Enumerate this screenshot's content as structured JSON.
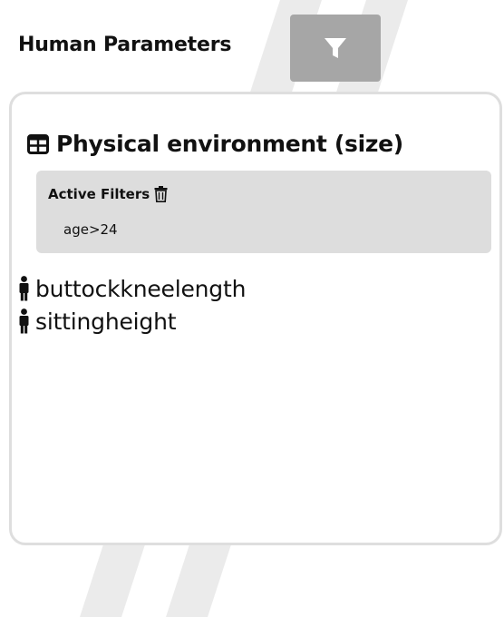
{
  "header": {
    "title": "Human Parameters",
    "filter_button_icon": "filter-icon"
  },
  "panel": {
    "title_icon": "table-icon",
    "title": "Physical environment (size)",
    "active_filters": {
      "label": "Active Filters",
      "delete_icon": "trash-icon",
      "items": [
        "age>24"
      ]
    },
    "parameters": [
      {
        "icon": "person-icon",
        "label": "buttockkneelength"
      },
      {
        "icon": "person-icon",
        "label": "sittingheight"
      }
    ]
  },
  "colors": {
    "filter_button_bg": "#a6a6a6",
    "active_filters_bg": "#dddddd",
    "panel_border": "#dedede",
    "background_stripe": "#ebebeb",
    "text": "#111111"
  }
}
